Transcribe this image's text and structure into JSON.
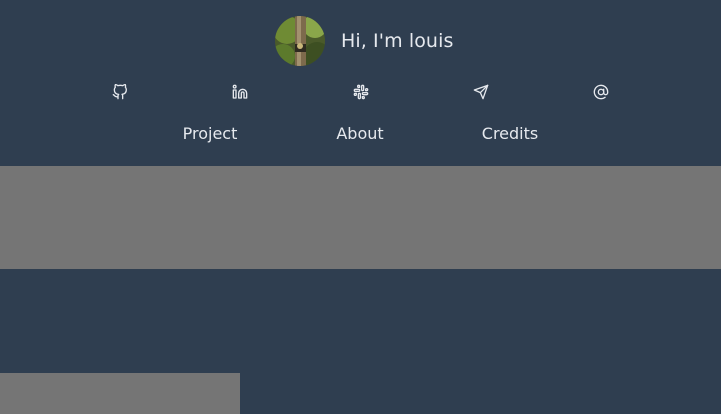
{
  "header": {
    "greeting": "Hi, I'm louis"
  },
  "social": [
    {
      "icon": "github-icon"
    },
    {
      "icon": "linkedin-icon"
    },
    {
      "icon": "slack-icon"
    },
    {
      "icon": "send-icon"
    },
    {
      "icon": "at-sign-icon"
    }
  ],
  "nav": {
    "project": "Project",
    "about": "About",
    "credits": "Credits"
  },
  "colors": {
    "background": "#2f3e50",
    "panel": "#757575",
    "text": "#e6e9ee"
  }
}
